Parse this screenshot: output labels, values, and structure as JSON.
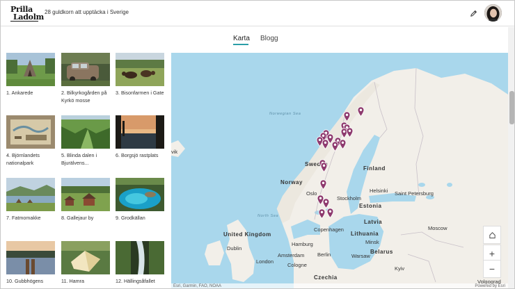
{
  "header": {
    "logo_line1": "Prilla",
    "logo_line2": "Ladolm",
    "title": "28 guldkorn att upptäcka i Sverige"
  },
  "tabs": [
    {
      "label": "Karta",
      "active": true
    },
    {
      "label": "Blogg",
      "active": false
    }
  ],
  "gallery": [
    {
      "caption": "1. Ankarede"
    },
    {
      "caption": "2. Bilkyrkogården på Kyrkö mosse"
    },
    {
      "caption": "3. Bisonfarmen i Gate"
    },
    {
      "caption": "4. Björnlandets nationalpark"
    },
    {
      "caption": "5. Blinda dalen i Bjurälvens..."
    },
    {
      "caption": "6. Borgsjö rastplats"
    },
    {
      "caption": "7. Fatmomakke"
    },
    {
      "caption": "8. Gallejaur by"
    },
    {
      "caption": "9. Grodkällan"
    },
    {
      "caption": "10. Gubbhögens"
    },
    {
      "caption": "11. Hamra"
    },
    {
      "caption": "12. Hällingsåfallet"
    }
  ],
  "map": {
    "labels": {
      "norwegian_sea": "Norwegian Sea",
      "north_sea": "North Sea",
      "vik": "vik",
      "sweden": "Sweden",
      "finland": "Finland",
      "norway": "Norway",
      "oslo": "Oslo",
      "helsinki": "Helsinki",
      "saint_petersburg": "Saint Petersburg",
      "stockholm": "Stockholm",
      "estonia": "Estonia",
      "latvia": "Latvia",
      "copenhagen": "Copenhagen",
      "lithuania": "Lithuania",
      "united_kingdom": "United Kingdom",
      "dublin": "Dublin",
      "moscow": "Moscow",
      "minsk": "Minsk",
      "belarus": "Belarus",
      "hamburg": "Hamburg",
      "amsterdam": "Amsterdam",
      "berlin": "Berlin",
      "warsaw": "Warsaw",
      "london": "London",
      "cologne": "Cologne",
      "kyiv": "Kyiv",
      "czechia": "Czechia",
      "volgograd": "Volgograd"
    },
    "attribution": "Esri, Garmin, FAO, NOAA",
    "powered_by": "Powered by Esri",
    "zoom_in": "+",
    "zoom_out": "−",
    "pin_color": "#8e3a6e",
    "water_color": "#a9d7ec",
    "land_color": "#f2efe9"
  },
  "accent_color": "#2b9ea7"
}
